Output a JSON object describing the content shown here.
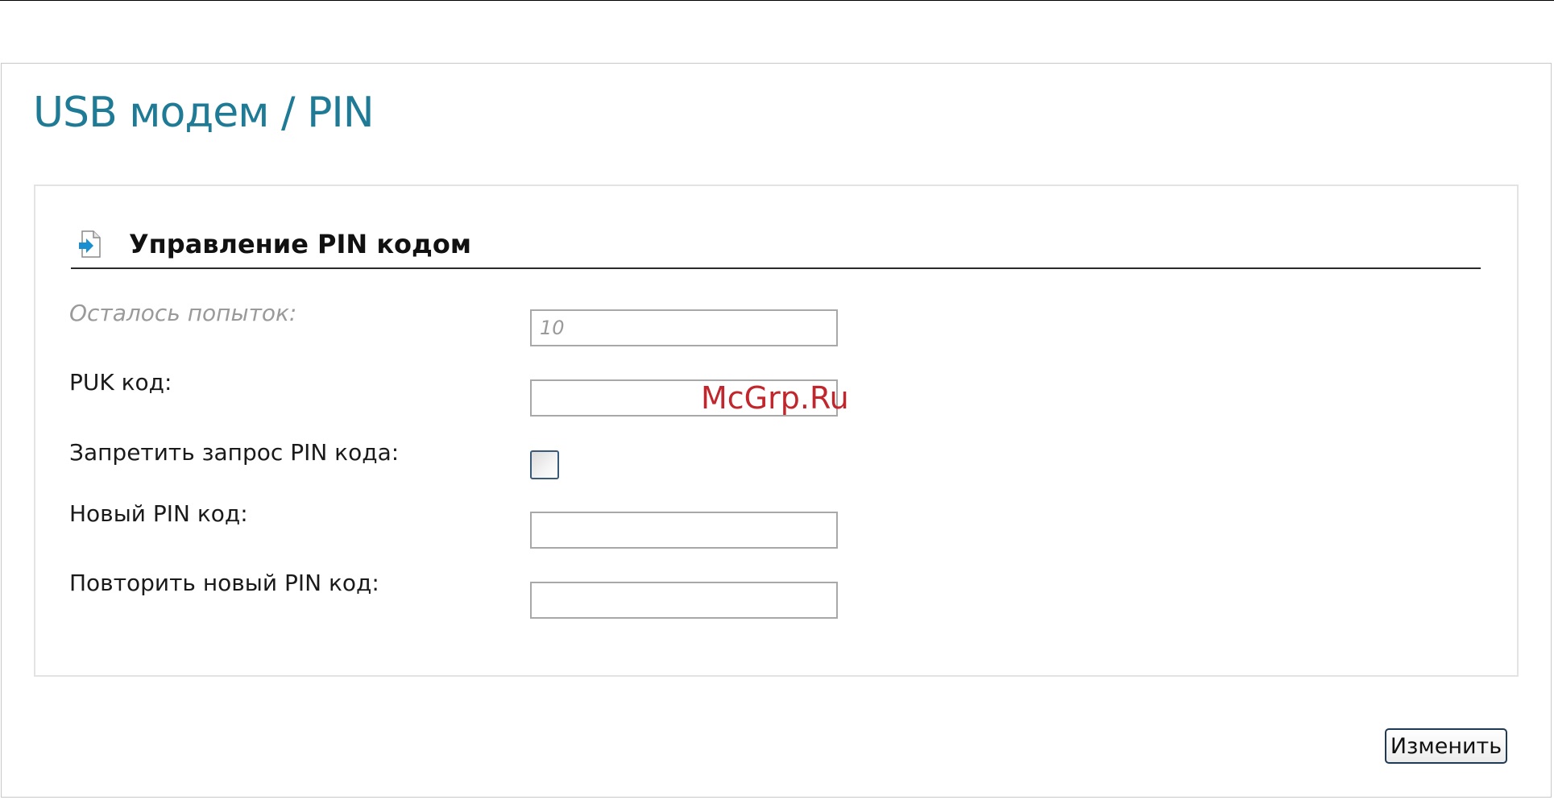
{
  "page": {
    "title": "USB модем / PIN"
  },
  "section": {
    "title": "Управление PIN кодом",
    "icon": "page-arrow-icon"
  },
  "fields": {
    "attempts_left": {
      "label": "Осталось попыток:",
      "value": "10"
    },
    "puk_code": {
      "label": "PUK код:",
      "value": ""
    },
    "disable_pin_request": {
      "label": "Запретить запрос PIN кода:",
      "checked": false
    },
    "new_pin": {
      "label": "Новый PIN код:",
      "value": ""
    },
    "repeat_new_pin": {
      "label": "Повторить новый PIN код:",
      "value": ""
    }
  },
  "actions": {
    "apply_label": "Изменить"
  },
  "watermark": {
    "text": "McGrp.Ru"
  },
  "colors": {
    "title": "#1f7b95",
    "watermark": "#c0262c",
    "icon_accent": "#1a8fd0"
  }
}
